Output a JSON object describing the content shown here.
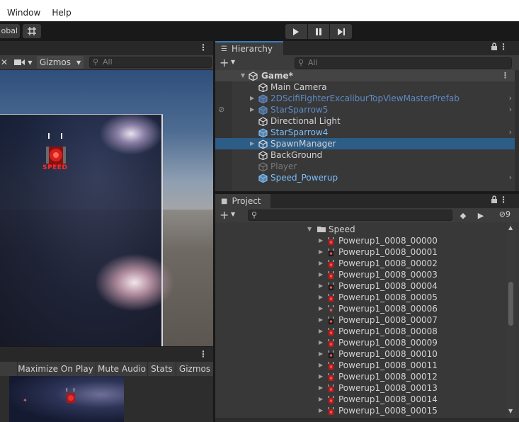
{
  "menu": [
    "Window",
    "Help"
  ],
  "toolbar": {
    "global_label": "obal"
  },
  "scene": {
    "search_placeholder": "All",
    "gizmos_label": "Gizmos",
    "sprite_caption": "SPEED"
  },
  "game": {
    "buttons": [
      "Maximize On Play",
      "Mute Audio",
      "Stats",
      "Gizmos"
    ]
  },
  "hierarchy": {
    "tab_label": "Hierarchy",
    "search_placeholder": "All",
    "scene_name": "Game*",
    "items": [
      {
        "name": "Main Camera",
        "style": "normal",
        "expandable": false,
        "chevron": false
      },
      {
        "name": "2DScifiFighterExcaliburTopViewMasterPrefab",
        "style": "prefab-dim",
        "expandable": true,
        "chevron": true
      },
      {
        "name": "StarSparrow5",
        "style": "prefab-dim",
        "expandable": true,
        "chevron": true
      },
      {
        "name": "Directional Light",
        "style": "normal",
        "expandable": false,
        "chevron": false
      },
      {
        "name": "StarSparrow4",
        "style": "prefab",
        "expandable": false,
        "chevron": true
      },
      {
        "name": "SpawnManager",
        "style": "selected",
        "expandable": true,
        "chevron": false
      },
      {
        "name": "BackGround",
        "style": "normal",
        "expandable": false,
        "chevron": false
      },
      {
        "name": "Player",
        "style": "disabled",
        "expandable": false,
        "chevron": false
      },
      {
        "name": "Speed_Powerup",
        "style": "prefab",
        "expandable": false,
        "chevron": true
      }
    ]
  },
  "project": {
    "tab_label": "Project",
    "hidden_count": "9",
    "folder": "Speed",
    "items": [
      "Powerup1_0008_00000",
      "Powerup1_0008_00001",
      "Powerup1_0008_00002",
      "Powerup1_0008_00003",
      "Powerup1_0008_00004",
      "Powerup1_0008_00005",
      "Powerup1_0008_00006",
      "Powerup1_0008_00007",
      "Powerup1_0008_00008",
      "Powerup1_0008_00009",
      "Powerup1_0008_00010",
      "Powerup1_0008_00011",
      "Powerup1_0008_00012",
      "Powerup1_0008_00013",
      "Powerup1_0008_00014",
      "Powerup1_0008_00015"
    ]
  },
  "colors": {
    "selection": "#2c5d87",
    "prefab": "#7cbdfc",
    "tab_accent": "#3a79bb"
  }
}
